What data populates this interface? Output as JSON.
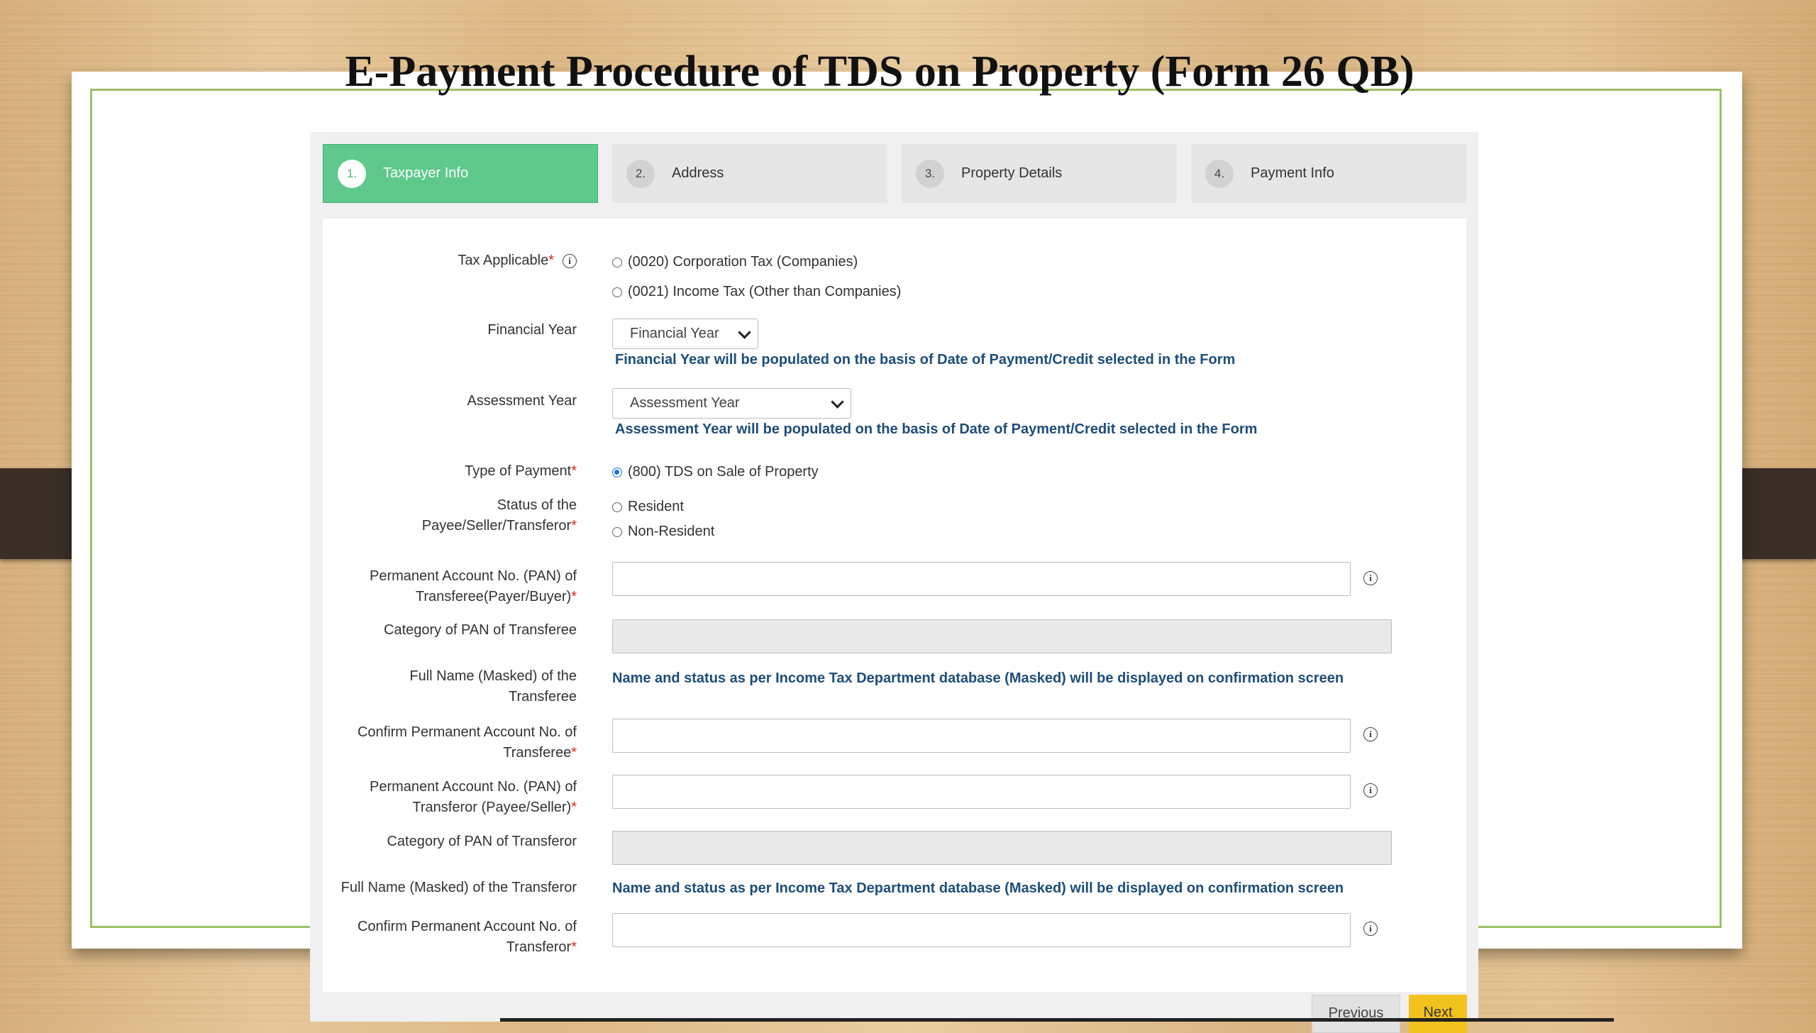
{
  "slide": {
    "title": "E-Payment Procedure of  TDS on Property (Form 26 QB)"
  },
  "steps": [
    {
      "num": "1.",
      "label": "Taxpayer Info",
      "active": true
    },
    {
      "num": "2.",
      "label": "Address",
      "active": false
    },
    {
      "num": "3.",
      "label": "Property Details",
      "active": false
    },
    {
      "num": "4.",
      "label": "Payment Info",
      "active": false
    }
  ],
  "form": {
    "tax_applicable": {
      "label": "Tax Applicable",
      "options": [
        "(0020) Corporation Tax (Companies)",
        "(0021) Income Tax (Other than Companies)"
      ]
    },
    "financial_year": {
      "label": "Financial Year",
      "selected": "Financial Year",
      "hint": "Financial Year will be populated on the basis of Date of Payment/Credit selected in the Form"
    },
    "assessment_year": {
      "label": "Assessment Year",
      "selected": "Assessment Year",
      "hint": "Assessment Year will be populated on the basis of Date of Payment/Credit selected in the Form"
    },
    "type_of_payment": {
      "label": "Type of Payment",
      "option": "(800) TDS on Sale of Property"
    },
    "status_payee": {
      "label_line1": "Status of the",
      "label_line2": "Payee/Seller/Transferor",
      "options": [
        "Resident",
        "Non-Resident"
      ]
    },
    "pan_transferee": {
      "label_line1": "Permanent Account No. (PAN) of",
      "label_line2": "Transferee(Payer/Buyer)"
    },
    "category_transferee": {
      "label": "Category of PAN of Transferee"
    },
    "name_transferee": {
      "label_line1": "Full Name (Masked) of the",
      "label_line2": "Transferee",
      "note": "Name and status as per Income Tax Department database (Masked) will be displayed on confirmation screen"
    },
    "confirm_pan_transferee": {
      "label_line1": "Confirm Permanent Account No. of",
      "label_line2": "Transferee"
    },
    "pan_transferor": {
      "label_line1": "Permanent Account No. (PAN) of",
      "label_line2": "Transferor (Payee/Seller)"
    },
    "category_transferor": {
      "label": "Category of PAN of Transferor"
    },
    "name_transferor": {
      "label": "Full Name (Masked) of the Transferor",
      "note": "Name and status as per Income Tax Department database (Masked) will be displayed on confirmation screen"
    },
    "confirm_pan_transferor": {
      "label_line1": "Confirm Permanent Account No. of",
      "label_line2": "Transferor"
    },
    "required_mark": "*",
    "info_glyph": "i"
  },
  "buttons": {
    "previous": "Previous",
    "next": "Next"
  }
}
